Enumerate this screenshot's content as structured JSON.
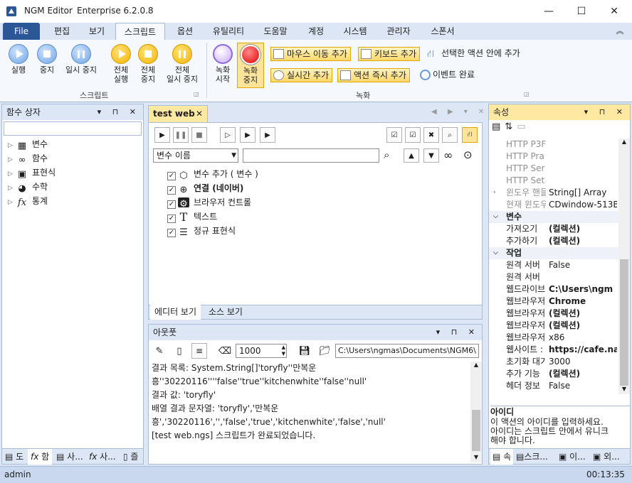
{
  "window": {
    "app_title": "NGM Editor",
    "edition": "Enterprise 6.2.0.8",
    "minimize": "—",
    "maximize": "☐",
    "close": "✕"
  },
  "menu": {
    "tabs": [
      "File",
      "편집",
      "보기",
      "스크립트",
      "옵션",
      "유틸리티",
      "도움말",
      "계정",
      "시스템",
      "관리자",
      "스폰서"
    ],
    "active": "스크립트",
    "collapse": "︽"
  },
  "ribbon": {
    "script_group": {
      "label": "스크립트",
      "run": "실행",
      "stop": "중지",
      "pause": "일시 중지",
      "run_all_1": "전체",
      "run_all_2": "실행",
      "stop_all_1": "전체",
      "stop_all_2": "중지",
      "pause_all_1": "전체",
      "pause_all_2": "일시 중지"
    },
    "record_group": {
      "label": "녹화",
      "start_1": "녹화",
      "start_2": "시작",
      "stop_1": "녹화",
      "stop_2": "중지",
      "mouse_move": "마우스 이동 추가",
      "keyboard": "키보드 추가",
      "in_selected": "선택한 액션 안에 추가",
      "realtime": "실시간 추가",
      "action_now": "액션 즉시 추가",
      "event_done": "이벤트 완료"
    }
  },
  "left_panel": {
    "title": "함수 상자",
    "items": [
      "변수",
      "함수",
      "표현식",
      "수학",
      "통계"
    ],
    "bottom_tabs": [
      "도",
      "함",
      "사...",
      "사...",
      "즐"
    ]
  },
  "editor": {
    "tab_title": "test web",
    "dropdown_value": "변수 이름",
    "search_value": "",
    "items": [
      {
        "label": "변수 추가 ( 변수 )",
        "bold": false
      },
      {
        "label": "연결 (네이버)",
        "bold": true
      },
      {
        "label": "브라우저 컨트롤",
        "bold": false
      },
      {
        "label": "텍스트",
        "bold": false
      },
      {
        "label": "정규 표현식",
        "bold": false
      }
    ],
    "bottom_tabs": [
      "에디터 보기",
      "소스 보기"
    ]
  },
  "output": {
    "title": "아웃풋",
    "count": "1000",
    "path": "C:\\Users\\ngmas\\Documents\\NGM6\\",
    "lines": [
      "결과 목록: System.String[]'toryfly''만복운",
      "흥''30220116''''false''true''kitchenwhite''false''null'",
      "결과 값: 'toryfly'",
      "배열 결과 문자열: 'toryfly','만복운",
      "흥','30220116','','false','true','kitchenwhite','false','null'",
      "[test web.ngs] 스크립트가 완료되었습니다."
    ]
  },
  "properties": {
    "title": "속성",
    "rows": [
      {
        "name": "HTTP P3F",
        "value": "",
        "type": "gray"
      },
      {
        "name": "HTTP Pra",
        "value": "",
        "type": "gray"
      },
      {
        "name": "HTTP Ser",
        "value": "",
        "type": "gray"
      },
      {
        "name": "HTTP Set",
        "value": "",
        "type": "gray"
      },
      {
        "name": "윈도우 핸들",
        "value": "String[] Array",
        "type": "gray-exp"
      },
      {
        "name": "현재 윈도우",
        "value": "CDwindow-513B",
        "type": "gray"
      },
      {
        "name": "변수",
        "value": "",
        "type": "cat"
      },
      {
        "name": "가져오기",
        "value": "(컬렉션)",
        "type": "bold"
      },
      {
        "name": "추가하기",
        "value": "(컬렉션)",
        "type": "bold"
      },
      {
        "name": "작업",
        "value": "",
        "type": "cat"
      },
      {
        "name": "원격 서버",
        "value": "False",
        "type": "normal"
      },
      {
        "name": "원격 서버",
        "value": "",
        "type": "normal"
      },
      {
        "name": "웹드라이브",
        "value": "C:\\Users\\ngm",
        "type": "bold"
      },
      {
        "name": "웹브라우저",
        "value": "Chrome",
        "type": "bold"
      },
      {
        "name": "웹브라우저",
        "value": "(컬렉션)",
        "type": "bold"
      },
      {
        "name": "웹브라우저",
        "value": "(컬렉션)",
        "type": "bold"
      },
      {
        "name": "웹브라우저",
        "value": "x86",
        "type": "normal"
      },
      {
        "name": "웹사이트 :",
        "value": "https://cafe.na",
        "type": "bold"
      },
      {
        "name": "초기화 대기",
        "value": "3000",
        "type": "normal"
      },
      {
        "name": "추가 기능",
        "value": "(컬렉션)",
        "type": "bold"
      },
      {
        "name": "헤더 정보",
        "value": "False",
        "type": "normal"
      }
    ],
    "desc_title": "아이디",
    "desc_text_1": "이 액션의 아이디를 입력하세요.",
    "desc_text_2": "아이디는 스크립트 안에서 유니크",
    "desc_text_3": "해야 합니다.",
    "bottom_tabs": [
      "속",
      "스크...",
      "이...",
      "외..."
    ]
  },
  "status": {
    "user": "admin",
    "time": "00:13:35"
  },
  "colors": {
    "accent": "#2b5797",
    "ribbon_bg": "#f5f8fd",
    "panel_header": "#dce6f4",
    "active_header": "#ffe9a2"
  }
}
